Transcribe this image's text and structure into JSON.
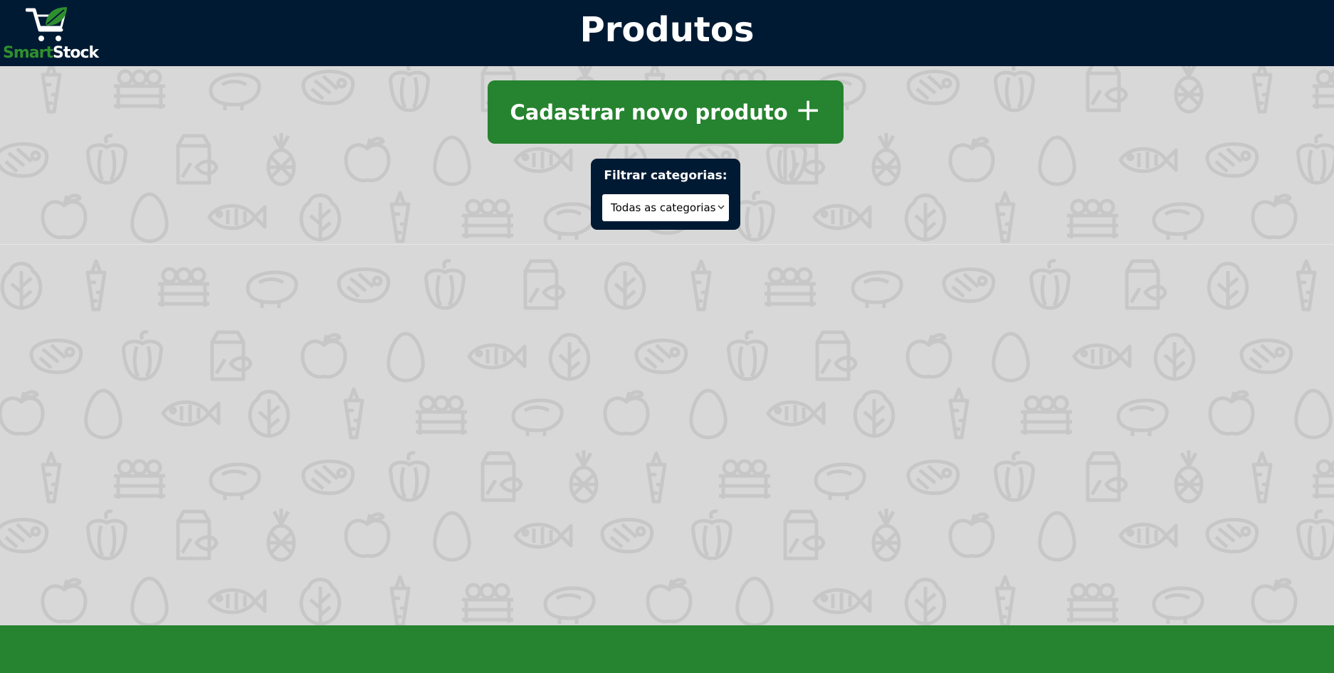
{
  "header": {
    "logo": {
      "text_part1": "Smart",
      "text_part2": "Stock",
      "icon": "shopping-cart-leaf-icon"
    },
    "title": "Produtos"
  },
  "main": {
    "new_product_button": {
      "label": "Cadastrar novo produto",
      "icon": "plus-icon",
      "icon_glyph": "+"
    },
    "filter": {
      "label": "Filtrar categorias:",
      "select_value": "Todas as categorias"
    },
    "background_icons": [
      "carrot-icon",
      "vegetable-crate-icon",
      "chicken-icon",
      "meat-icon",
      "bell-pepper-icon",
      "milk-carton-icon",
      "pineapple-icon",
      "apple-icon",
      "egg-icon",
      "fish-icon",
      "lettuce-icon"
    ]
  },
  "colors": {
    "header_bg": "#001a33",
    "accent_green": "#26832f",
    "content_bg": "#d8d8d8",
    "logo_green": "#2f8f2f",
    "pattern_icon": "#c7c7c7"
  }
}
